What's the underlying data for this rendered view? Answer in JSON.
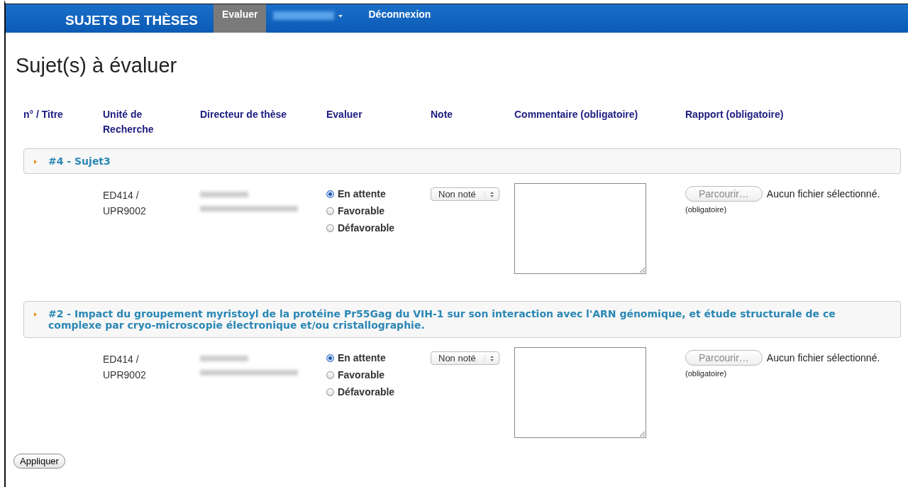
{
  "nav": {
    "brand": "SUJETS DE THÈSES",
    "items": [
      {
        "kind": "link",
        "label": "Evaluer",
        "selected": true
      },
      {
        "kind": "redacted",
        "selected": false
      },
      {
        "kind": "link",
        "label": "Déconnexion",
        "selected": false
      }
    ]
  },
  "page_title": "Sujet(s) à évaluer",
  "table": {
    "columns": [
      "n° / Titre",
      "Unité de Recherche",
      "Directeur de thèse",
      "Evaluer",
      "Note",
      "Commentaire (obligatoire)",
      "Rapport (obligatoire)"
    ],
    "subjects": [
      {
        "title": "#4 - Sujet3",
        "unit": "ED414 / UPR9002",
        "options": [
          {
            "label": "En attente",
            "selected": true
          },
          {
            "label": "Favorable",
            "selected": false
          },
          {
            "label": "Défavorable",
            "selected": false
          }
        ],
        "note": "Non noté",
        "file_button": "Parcourir…",
        "file_status": "Aucun fichier sélectionné.",
        "file_hint": "(obligatoire)"
      },
      {
        "title": "#2 - Impact du groupement myristoyl de la protéine Pr55Gag du VIH-1 sur son interaction avec l'ARN génomique, et étude structurale de ce complexe par cryo-microscopie électronique et/ou cristallographie.",
        "unit": "ED414 / UPR9002",
        "options": [
          {
            "label": "En attente",
            "selected": true
          },
          {
            "label": "Favorable",
            "selected": false
          },
          {
            "label": "Défavorable",
            "selected": false
          }
        ],
        "note": "Non noté",
        "file_button": "Parcourir…",
        "file_status": "Aucun fichier sélectionné.",
        "file_hint": "(obligatoire)"
      }
    ]
  },
  "apply_button": "Appliquer"
}
